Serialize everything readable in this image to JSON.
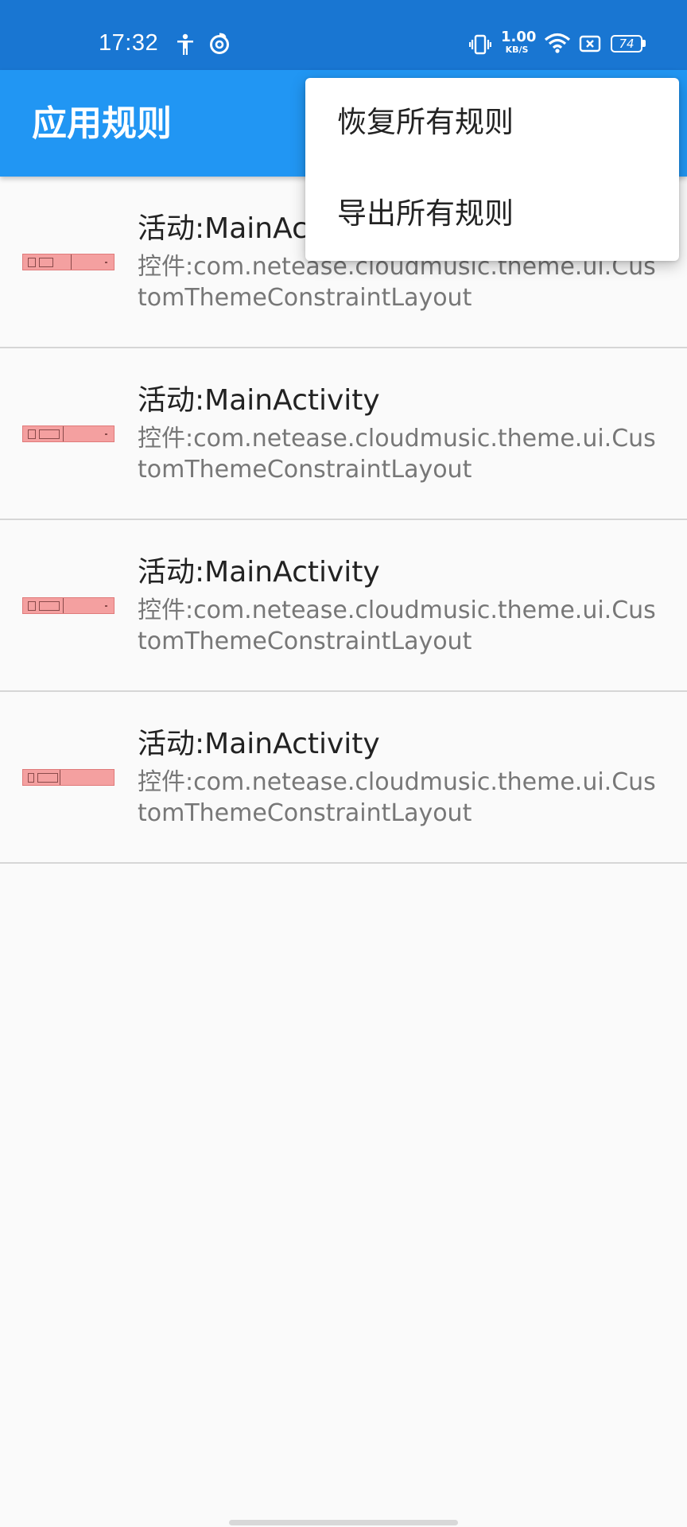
{
  "status_bar": {
    "time": "17:32",
    "net_speed_value": "1.00",
    "net_speed_unit": "KB/S",
    "battery": "74",
    "icons": [
      "accessibility-icon",
      "netease-music-icon",
      "vibrate-icon",
      "wifi-icon",
      "sim-icon",
      "battery-icon"
    ]
  },
  "app_bar": {
    "title": "应用规则",
    "color": "#2196f3"
  },
  "menu": {
    "items": [
      {
        "label": "恢复所有规则"
      },
      {
        "label": "导出所有规则"
      }
    ]
  },
  "rules": [
    {
      "activity": "活动:MainActivity",
      "widget": "控件:com.netease.cloudmusic.theme.ui.CustomThemeConstraintLayout"
    },
    {
      "activity": "活动:MainActivity",
      "widget": "控件:com.netease.cloudmusic.theme.ui.CustomThemeConstraintLayout"
    },
    {
      "activity": "活动:MainActivity",
      "widget": "控件:com.netease.cloudmusic.theme.ui.CustomThemeConstraintLayout"
    },
    {
      "activity": "活动:MainActivity",
      "widget": "控件:com.netease.cloudmusic.theme.ui.CustomThemeConstraintLayout"
    }
  ]
}
